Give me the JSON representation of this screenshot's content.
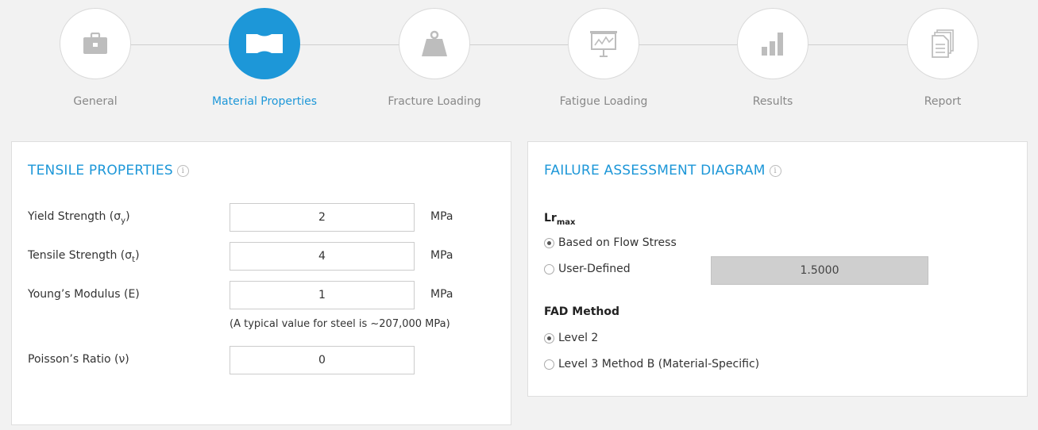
{
  "steps": [
    {
      "label": "General",
      "icon": "briefcase-icon"
    },
    {
      "label": "Material Properties",
      "icon": "material-specimen-icon",
      "active": true
    },
    {
      "label": "Fracture Loading",
      "icon": "weight-icon"
    },
    {
      "label": "Fatigue Loading",
      "icon": "chart-board-icon"
    },
    {
      "label": "Results",
      "icon": "bar-chart-icon"
    },
    {
      "label": "Report",
      "icon": "document-icon"
    }
  ],
  "colors": {
    "accent": "#1d97d8"
  },
  "tensile": {
    "title": "TENSILE PROPERTIES",
    "yield": {
      "label": "Yield Strength (σ",
      "sub": "y",
      "close": ")",
      "value": "2",
      "unit": "MPa"
    },
    "tensile": {
      "label": "Tensile Strength (σ",
      "sub": "t",
      "close": ")",
      "value": "4",
      "unit": "MPa"
    },
    "youngs": {
      "label": "Young’s Modulus (E)",
      "value": "1",
      "unit": "MPa",
      "note": "(A typical value for steel is ~207,000 MPa)"
    },
    "poisson": {
      "label": "Poisson’s Ratio (ν)",
      "value": "0"
    }
  },
  "fad": {
    "title": "FAILURE ASSESSMENT DIAGRAM",
    "lrmax_label": "Lr",
    "lrmax_sub": "max",
    "flow_stress_label": "Based on Flow Stress",
    "user_defined_label": "User-Defined",
    "user_defined_value": "1.5000",
    "method_label": "FAD Method",
    "level2_label": "Level 2",
    "level3_label": "Level 3 Method B (Material-Specific)"
  }
}
